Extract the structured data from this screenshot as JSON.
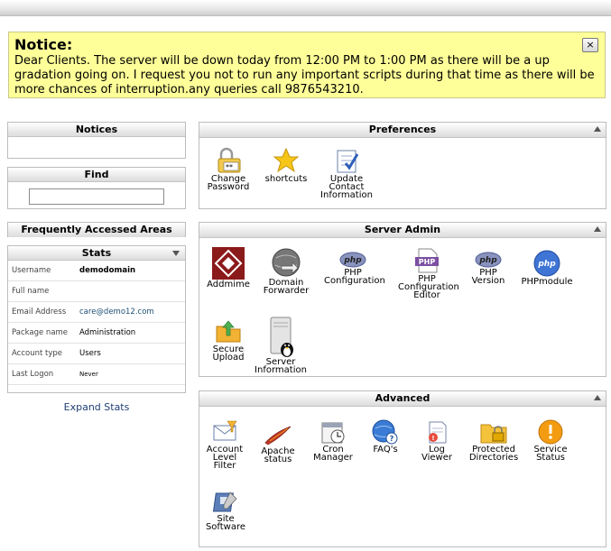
{
  "notice": {
    "title": "Notice:",
    "message": "Dear Clients. The server will be down today from 12:00 PM to 1:00 PM as there will be a up gradation going on. I request you not to run any important scripts during that time as there will be more chances of interruption.any queries call 9876543210.",
    "close_label": "×"
  },
  "sidebar": {
    "notices_title": "Notices",
    "find_title": "Find",
    "find_value": "",
    "frequent_title": "Frequently Accessed Areas",
    "stats_title": "Stats",
    "stats_rows": [
      {
        "label": "Username",
        "value": "demodomain"
      },
      {
        "label": "Full name",
        "value": ""
      },
      {
        "label": "Email Address",
        "value": "care@demo12.com"
      },
      {
        "label": "Package name",
        "value": "Administration"
      },
      {
        "label": "Account type",
        "value": "Users"
      },
      {
        "label": "Last Logon",
        "value": "Never"
      }
    ],
    "expand_label": "Expand Stats"
  },
  "panels": {
    "preferences": {
      "title": "Preferences",
      "items": [
        {
          "line1": "Change",
          "line2": "Password",
          "line3": "",
          "icon": "lock-keys-icon"
        },
        {
          "line1": "shortcuts",
          "line2": "",
          "line3": "",
          "icon": "star-icon"
        },
        {
          "line1": "Update",
          "line2": "Contact",
          "line3": "Information",
          "icon": "contact-form-icon"
        }
      ]
    },
    "server_admin": {
      "title": "Server Admin",
      "items": [
        {
          "line1": "Addmime",
          "line2": "",
          "line3": "",
          "icon": "addmime-icon"
        },
        {
          "line1": "Domain",
          "line2": "Forwarder",
          "line3": "",
          "icon": "globe-arrow-icon"
        },
        {
          "line1": "PHP",
          "line2": "Configuration",
          "line3": "",
          "icon": "php-icon"
        },
        {
          "line1": "PHP",
          "line2": "Configuration",
          "line3": "Editor",
          "icon": "php-editor-icon"
        },
        {
          "line1": "PHP",
          "line2": "Version",
          "line3": "",
          "icon": "php-icon"
        },
        {
          "line1": "PHPmodule",
          "line2": "",
          "line3": "",
          "icon": "php-blue-icon"
        },
        {
          "line1": "Secure",
          "line2": "Upload",
          "line3": "",
          "icon": "upload-folder-icon"
        },
        {
          "line1": "Server",
          "line2": "Information",
          "line3": "",
          "icon": "server-linux-icon"
        }
      ]
    },
    "advanced": {
      "title": "Advanced",
      "items": [
        {
          "line1": "Account",
          "line2": "Level",
          "line3": "Filter",
          "icon": "mail-filter-icon"
        },
        {
          "line1": "Apache",
          "line2": "status",
          "line3": "",
          "icon": "apache-feather-icon"
        },
        {
          "line1": "Cron",
          "line2": "Manager",
          "line3": "",
          "icon": "cron-calendar-icon"
        },
        {
          "line1": "FAQ's",
          "line2": "",
          "line3": "",
          "icon": "faq-globe-icon"
        },
        {
          "line1": "Log",
          "line2": "Viewer",
          "line3": "",
          "icon": "log-viewer-icon"
        },
        {
          "line1": "Protected",
          "line2": "Directories",
          "line3": "",
          "icon": "protected-folder-icon"
        },
        {
          "line1": "Service",
          "line2": "Status",
          "line3": "",
          "icon": "warning-icon"
        },
        {
          "line1": "Site",
          "line2": "Software",
          "line3": "",
          "icon": "site-software-icon"
        }
      ]
    }
  },
  "colors": {
    "notice_bg": "#ffff99",
    "link": "#1e3f73",
    "email_link": "#1e4f74"
  }
}
